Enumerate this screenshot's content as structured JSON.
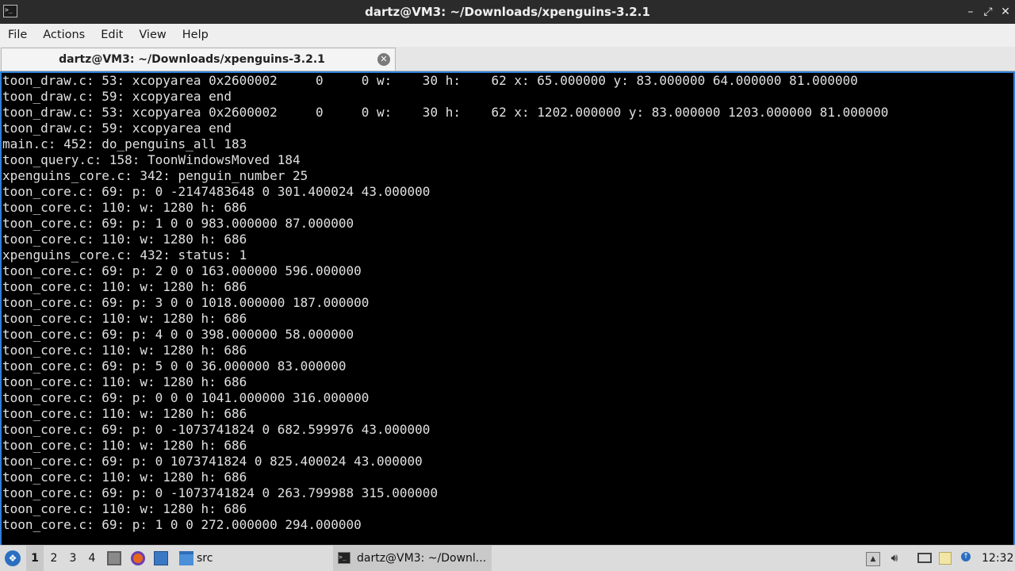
{
  "window": {
    "title": "dartz@VM3: ~/Downloads/xpenguins-3.2.1",
    "controls": [
      "–",
      "⤢",
      "✕"
    ]
  },
  "menu": [
    "File",
    "Actions",
    "Edit",
    "View",
    "Help"
  ],
  "tab": {
    "label": "dartz@VM3: ~/Downloads/xpenguins-3.2.1",
    "close": "✕"
  },
  "terminal": {
    "lines": [
      "toon_draw.c: 53: xcopyarea 0x2600002     0     0 w:    30 h:    62 x: 65.000000 y: 83.000000 64.000000 81.000000",
      "toon_draw.c: 59: xcopyarea end",
      "toon_draw.c: 53: xcopyarea 0x2600002     0     0 w:    30 h:    62 x: 1202.000000 y: 83.000000 1203.000000 81.000000",
      "toon_draw.c: 59: xcopyarea end",
      "main.c: 452: do_penguins_all 183",
      "toon_query.c: 158: ToonWindowsMoved 184",
      "xpenguins_core.c: 342: penguin_number 25",
      "toon_core.c: 69: p: 0 -2147483648 0 301.400024 43.000000",
      "toon_core.c: 110: w: 1280 h: 686",
      "toon_core.c: 69: p: 1 0 0 983.000000 87.000000",
      "toon_core.c: 110: w: 1280 h: 686",
      "xpenguins_core.c: 432: status: 1",
      "toon_core.c: 69: p: 2 0 0 163.000000 596.000000",
      "toon_core.c: 110: w: 1280 h: 686",
      "toon_core.c: 69: p: 3 0 0 1018.000000 187.000000",
      "toon_core.c: 110: w: 1280 h: 686",
      "toon_core.c: 69: p: 4 0 0 398.000000 58.000000",
      "toon_core.c: 110: w: 1280 h: 686",
      "toon_core.c: 69: p: 5 0 0 36.000000 83.000000",
      "toon_core.c: 110: w: 1280 h: 686",
      "toon_core.c: 69: p: 0 0 0 1041.000000 316.000000",
      "toon_core.c: 110: w: 1280 h: 686",
      "toon_core.c: 69: p: 0 -1073741824 0 682.599976 43.000000",
      "toon_core.c: 110: w: 1280 h: 686",
      "toon_core.c: 69: p: 0 1073741824 0 825.400024 43.000000",
      "toon_core.c: 110: w: 1280 h: 686",
      "toon_core.c: 69: p: 0 -1073741824 0 263.799988 315.000000",
      "toon_core.c: 110: w: 1280 h: 686",
      "toon_core.c: 69: p: 1 0 0 272.000000 294.000000"
    ]
  },
  "taskbar": {
    "workspaces": [
      "1",
      "2",
      "3",
      "4"
    ],
    "launchers": [
      {
        "name": "file-manager-icon",
        "color": "#7a7a7a"
      },
      {
        "name": "firefox-icon",
        "color": "#e8661c"
      },
      {
        "name": "desktop-icon",
        "color": "#3b78c4"
      }
    ],
    "folder_label": "src",
    "task_label": "dartz@VM3: ~/Downl...",
    "clock": "12:32"
  },
  "colors": {
    "terminal_bg": "#000000",
    "terminal_fg": "#e0e0e0",
    "focus_border": "#2f7fd6",
    "titlebar": "#2b2b2b"
  }
}
